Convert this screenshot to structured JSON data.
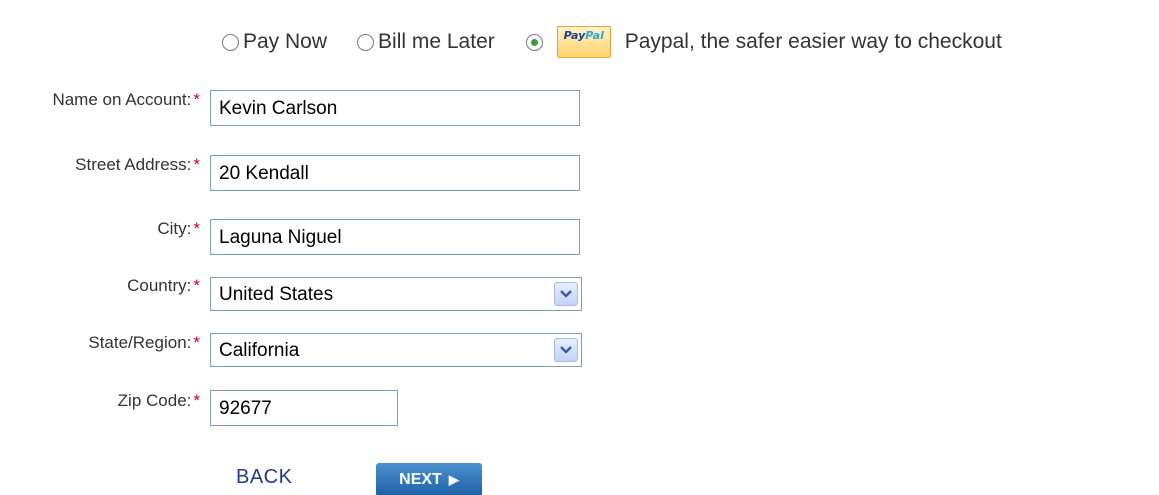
{
  "payment": {
    "options": [
      {
        "label": "Pay Now",
        "selected": false
      },
      {
        "label": "Bill me Later",
        "selected": false
      },
      {
        "label": "Paypal, the safer easier way to checkout",
        "selected": true
      }
    ],
    "paypal_logo": {
      "part1": "Pay",
      "part2": "Pal"
    }
  },
  "form": {
    "required_marker": "*",
    "name": {
      "label": "Name on Account:",
      "value": "Kevin Carlson"
    },
    "street": {
      "label": "Street Address:",
      "value": "20 Kendall"
    },
    "city": {
      "label": "City:",
      "value": "Laguna Niguel"
    },
    "country": {
      "label": "Country:",
      "value": "United States"
    },
    "state": {
      "label": "State/Region:",
      "value": "California"
    },
    "zip": {
      "label": "Zip Code:",
      "value": "92677"
    }
  },
  "buttons": {
    "back": "BACK",
    "next": "NEXT",
    "next_icon": "play-arrow-icon"
  },
  "colors": {
    "required": "#d0021b",
    "link": "#1f3a8e",
    "next_button": "#1d5fa7",
    "input_border": "#7f9db9"
  }
}
